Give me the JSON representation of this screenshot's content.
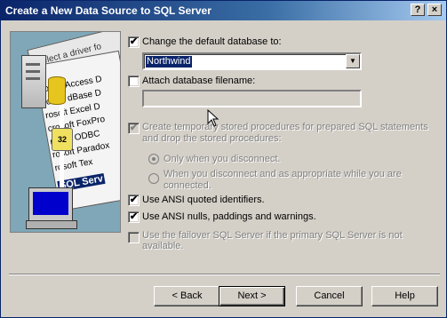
{
  "window": {
    "title": "Create a New Data Source to SQL Server",
    "help_button": "?",
    "close_button": "×"
  },
  "art": {
    "list_caption": "Select a driver fo",
    "drivers": [
      "rosoft Access D",
      "rosoft dBase D",
      "rosoft Excel D",
      "crosoft FoxPro",
      "rosoft ODBC",
      "rosoft Paradox",
      "rosoft Tex",
      "SQL Serv"
    ],
    "db_badge": "32"
  },
  "options": {
    "change_default_db": {
      "label": "Change the default database to:",
      "checked": true,
      "mark": "✔"
    },
    "database_value": "Northwind",
    "attach_filename": {
      "label": "Attach database filename:",
      "checked": false,
      "mark": ""
    },
    "attach_value": "",
    "create_temp": {
      "label_line1": "Create temporary stored procedures for prepared SQL statements",
      "label_line2": "and drop the stored procedures:",
      "checked": true,
      "mark": "✔"
    },
    "radio_only": "Only when you disconnect.",
    "radio_when_line1": "When you disconnect and as appropriate while you are",
    "radio_when_line2": "connected.",
    "ansi_quoted": {
      "label": "Use ANSI quoted identifiers.",
      "checked": true,
      "mark": "✔"
    },
    "ansi_nulls": {
      "label": "Use ANSI nulls, paddings and warnings.",
      "checked": true,
      "mark": "✔"
    },
    "failover": {
      "label_line1": "Use the failover SQL Server if the primary SQL Server is not",
      "label_line2": "available.",
      "checked": false,
      "mark": ""
    }
  },
  "buttons": {
    "back": "< Back",
    "next": "Next >",
    "cancel": "Cancel",
    "help": "Help"
  }
}
